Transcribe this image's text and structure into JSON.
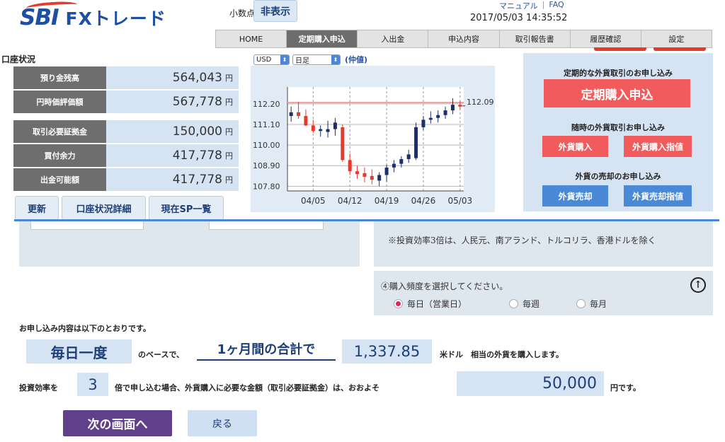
{
  "header": {
    "logo_sbi": "SBI",
    "logo_fx": "FXトレード",
    "decimal_label": "小数点",
    "decimal_button": "非表示",
    "manual_link": "マニュアル",
    "faq_link": "FAQ",
    "datetime": "2017/05/03 14:35:52"
  },
  "nav": {
    "items": [
      "HOME",
      "定期購入申込",
      "入出金",
      "申込内容",
      "取引報告書",
      "履歴確認",
      "設定"
    ],
    "active_index": 1
  },
  "account": {
    "title": "口座状況",
    "rows": [
      {
        "label": "預り金残高",
        "value": "564,043",
        "unit": "円"
      },
      {
        "label": "円時価評価額",
        "value": "567,778",
        "unit": "円"
      },
      {
        "label": "取引必要証拠金",
        "value": "150,000",
        "unit": "円"
      },
      {
        "label": "買付余力",
        "value": "417,778",
        "unit": "円"
      },
      {
        "label": "出金可能額",
        "value": "417,778",
        "unit": "円"
      }
    ],
    "buttons": [
      "更新",
      "口座状況詳細",
      "現在SP一覧"
    ]
  },
  "chart_controls": {
    "currency": "USD",
    "period": "日足",
    "price_type": "(仲値)"
  },
  "chart_data": {
    "type": "candlestick",
    "y_ticks": [
      112.2,
      111.1,
      110.0,
      108.9,
      107.8
    ],
    "x_ticks": [
      "04/05",
      "04/12",
      "04/19",
      "04/26",
      "05/03"
    ],
    "ylim": [
      107.55,
      113.1
    ],
    "current_price": 112.09,
    "current_label": "112.09",
    "reference_line": 112.27,
    "candles": [
      {
        "o": 111.55,
        "h": 112.05,
        "l": 111.25,
        "c": 111.75
      },
      {
        "o": 111.75,
        "h": 112.3,
        "l": 111.4,
        "c": 111.55
      },
      {
        "o": 111.55,
        "h": 111.9,
        "l": 111.0,
        "c": 111.05
      },
      {
        "o": 111.05,
        "h": 111.35,
        "l": 110.65,
        "c": 110.75
      },
      {
        "o": 110.75,
        "h": 111.05,
        "l": 110.45,
        "c": 110.85
      },
      {
        "o": 110.7,
        "h": 111.3,
        "l": 110.4,
        "c": 110.85
      },
      {
        "o": 110.85,
        "h": 111.45,
        "l": 110.5,
        "c": 111.2
      },
      {
        "o": 110.95,
        "h": 111.1,
        "l": 109.1,
        "c": 109.2
      },
      {
        "o": 109.2,
        "h": 109.55,
        "l": 108.4,
        "c": 108.6
      },
      {
        "o": 108.6,
        "h": 108.9,
        "l": 108.2,
        "c": 108.45
      },
      {
        "o": 108.5,
        "h": 108.8,
        "l": 108.0,
        "c": 108.3
      },
      {
        "o": 108.35,
        "h": 108.7,
        "l": 107.9,
        "c": 108.15
      },
      {
        "o": 108.1,
        "h": 108.55,
        "l": 107.8,
        "c": 108.4
      },
      {
        "o": 108.4,
        "h": 108.95,
        "l": 108.05,
        "c": 108.8
      },
      {
        "o": 108.8,
        "h": 109.2,
        "l": 108.55,
        "c": 109.0
      },
      {
        "o": 109.0,
        "h": 109.4,
        "l": 108.8,
        "c": 109.25
      },
      {
        "o": 109.25,
        "h": 109.75,
        "l": 109.05,
        "c": 109.5
      },
      {
        "o": 109.3,
        "h": 111.2,
        "l": 109.2,
        "c": 110.95
      },
      {
        "o": 110.95,
        "h": 111.55,
        "l": 110.8,
        "c": 111.35
      },
      {
        "o": 111.35,
        "h": 111.8,
        "l": 111.15,
        "c": 111.45
      },
      {
        "o": 111.45,
        "h": 111.85,
        "l": 111.2,
        "c": 111.6
      },
      {
        "o": 111.6,
        "h": 112.05,
        "l": 111.4,
        "c": 111.85
      },
      {
        "o": 111.85,
        "h": 112.5,
        "l": 111.65,
        "c": 112.15
      },
      {
        "o": 112.15,
        "h": 112.35,
        "l": 111.9,
        "c": 112.05
      }
    ],
    "up_color": "#1a2f6b",
    "down_color": "#e8392f"
  },
  "order_panel": {
    "regular_heading": "定期的な外貨取引のお申し込み",
    "regular_button": "定期購入申込",
    "spot_heading": "随時の外貨取引お申し込み",
    "spot_buy": "外貨購入",
    "spot_buy_limit": "外貨購入指値",
    "sell_heading": "外貨の売却のお申し込み",
    "sell": "外貨売却",
    "sell_limit": "外貨売却指値"
  },
  "form": {
    "note": "※投資効率3倍は、人民元、南アランド、トルコリラ、香港ドルを除く",
    "freq_question": "④購入頻度を選択してください。",
    "freq_options": [
      "毎日（営業日）",
      "毎週",
      "毎月"
    ],
    "freq_selected": 0
  },
  "summary": {
    "intro": "お申し込み内容は以下のとおりです。",
    "frequency": "毎日一度",
    "base_text": "のベースで、",
    "period_text": "1ヶ月間の合計で",
    "amount": "1,337.85",
    "amount_tail": "米ドル　相当の外貨を購入します。",
    "efficiency_label": "投資効率を",
    "efficiency": "3",
    "efficiency_tail": "倍で申し込む場合、外貨購入に必要な金額（取引必要証拠金）は、おおよそ",
    "required_amount": "50,000",
    "required_tail": "円です。"
  },
  "actions": {
    "next": "次の画面へ",
    "back": "戻る"
  },
  "colors": {
    "accent_red": "#f25b5b",
    "accent_blue": "#4a89d6",
    "nav_active": "#6d6d6d",
    "panel_bg": "#d6e3f2",
    "next_button": "#603f8b"
  }
}
